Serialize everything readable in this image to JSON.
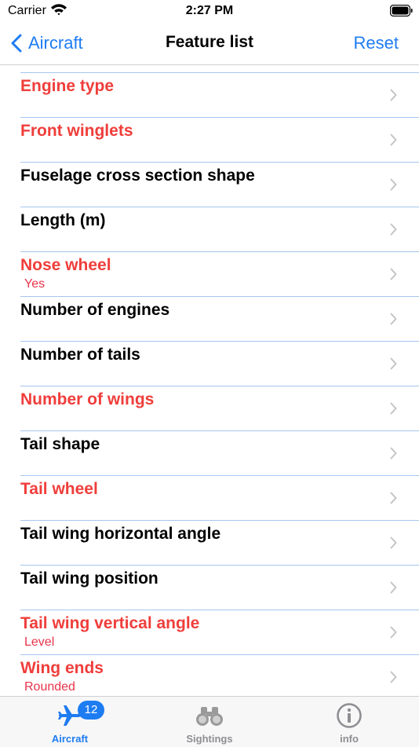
{
  "status_bar": {
    "carrier": "Carrier",
    "time": "2:27 PM"
  },
  "nav": {
    "back_label": "Aircraft",
    "title": "Feature list",
    "action_label": "Reset"
  },
  "colors": {
    "accent": "#1e7cf2",
    "selected_feature": "#ef3e3b",
    "value_text": "#e8344b",
    "separator": "#a5c7ee"
  },
  "features": [
    {
      "title": "Engine type",
      "value": "",
      "selected": true
    },
    {
      "title": "Front winglets",
      "value": "",
      "selected": true
    },
    {
      "title": "Fuselage cross section shape",
      "value": "",
      "selected": false
    },
    {
      "title": "Length (m)",
      "value": "",
      "selected": false
    },
    {
      "title": "Nose wheel",
      "value": "Yes",
      "selected": true
    },
    {
      "title": "Number of engines",
      "value": "",
      "selected": false
    },
    {
      "title": "Number of tails",
      "value": "",
      "selected": false
    },
    {
      "title": "Number of wings",
      "value": "",
      "selected": true
    },
    {
      "title": "Tail shape",
      "value": "",
      "selected": false
    },
    {
      "title": "Tail wheel",
      "value": "",
      "selected": true
    },
    {
      "title": "Tail wing horizontal angle",
      "value": "",
      "selected": false
    },
    {
      "title": "Tail wing position",
      "value": "",
      "selected": false
    },
    {
      "title": "Tail wing vertical angle",
      "value": "Level",
      "selected": true
    },
    {
      "title": "Wing ends",
      "value": "Rounded",
      "selected": true
    }
  ],
  "tabs": [
    {
      "label": "Aircraft",
      "icon": "airplane-icon",
      "badge": "12",
      "active": true
    },
    {
      "label": "Sightings",
      "icon": "binoculars-icon",
      "badge": "",
      "active": false
    },
    {
      "label": "info",
      "icon": "info-icon",
      "badge": "",
      "active": false
    }
  ]
}
